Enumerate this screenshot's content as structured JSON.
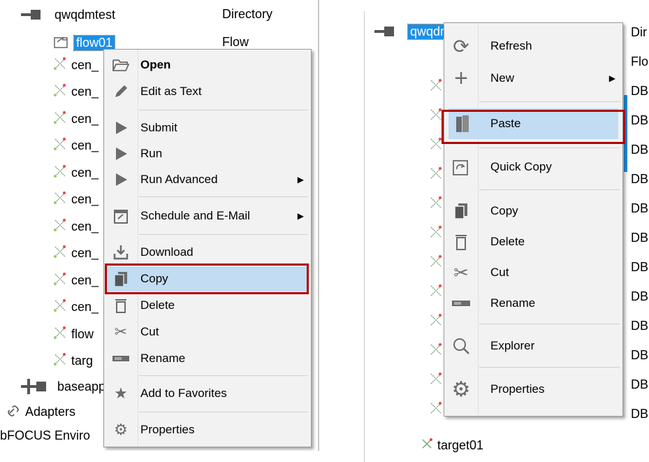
{
  "left": {
    "tree": {
      "root": {
        "name": "qwqdmtest",
        "type": "Directory"
      },
      "selected": {
        "name": "flow01",
        "type": "Flow"
      },
      "children": [
        "cen_",
        "cen_",
        "cen_",
        "cen_",
        "cen_",
        "cen_",
        "cen_",
        "cen_",
        "cen_",
        "cen_",
        "flow",
        "targ"
      ],
      "baseapp": "baseapp",
      "adapters": "Adapters",
      "environment": "bFOCUS Enviro"
    },
    "menu": {
      "open": "Open",
      "edit_as_text": "Edit as Text",
      "submit": "Submit",
      "run": "Run",
      "run_advanced": "Run Advanced",
      "schedule": "Schedule and E-Mail",
      "download": "Download",
      "copy": "Copy",
      "delete": "Delete",
      "cut": "Cut",
      "rename": "Rename",
      "add_to_favorites": "Add to Favorites",
      "properties": "Properties"
    }
  },
  "right": {
    "tree": {
      "root": "qwqdmtest",
      "types": [
        "Dir",
        "Flo",
        "DB",
        "DB",
        "DB",
        "DB",
        "DB",
        "DB",
        "DB",
        "DB",
        "DB",
        "DB",
        "DB",
        "DB"
      ],
      "last_item": "target01"
    },
    "menu": {
      "refresh": "Refresh",
      "new": "New",
      "paste": "Paste",
      "quick_copy": "Quick Copy",
      "copy": "Copy",
      "delete": "Delete",
      "cut": "Cut",
      "rename": "Rename",
      "explorer": "Explorer",
      "properties": "Properties"
    }
  },
  "colors": {
    "highlight": "#c2dcf3",
    "selection": "#1c8fe6",
    "callout": "#b00000"
  }
}
